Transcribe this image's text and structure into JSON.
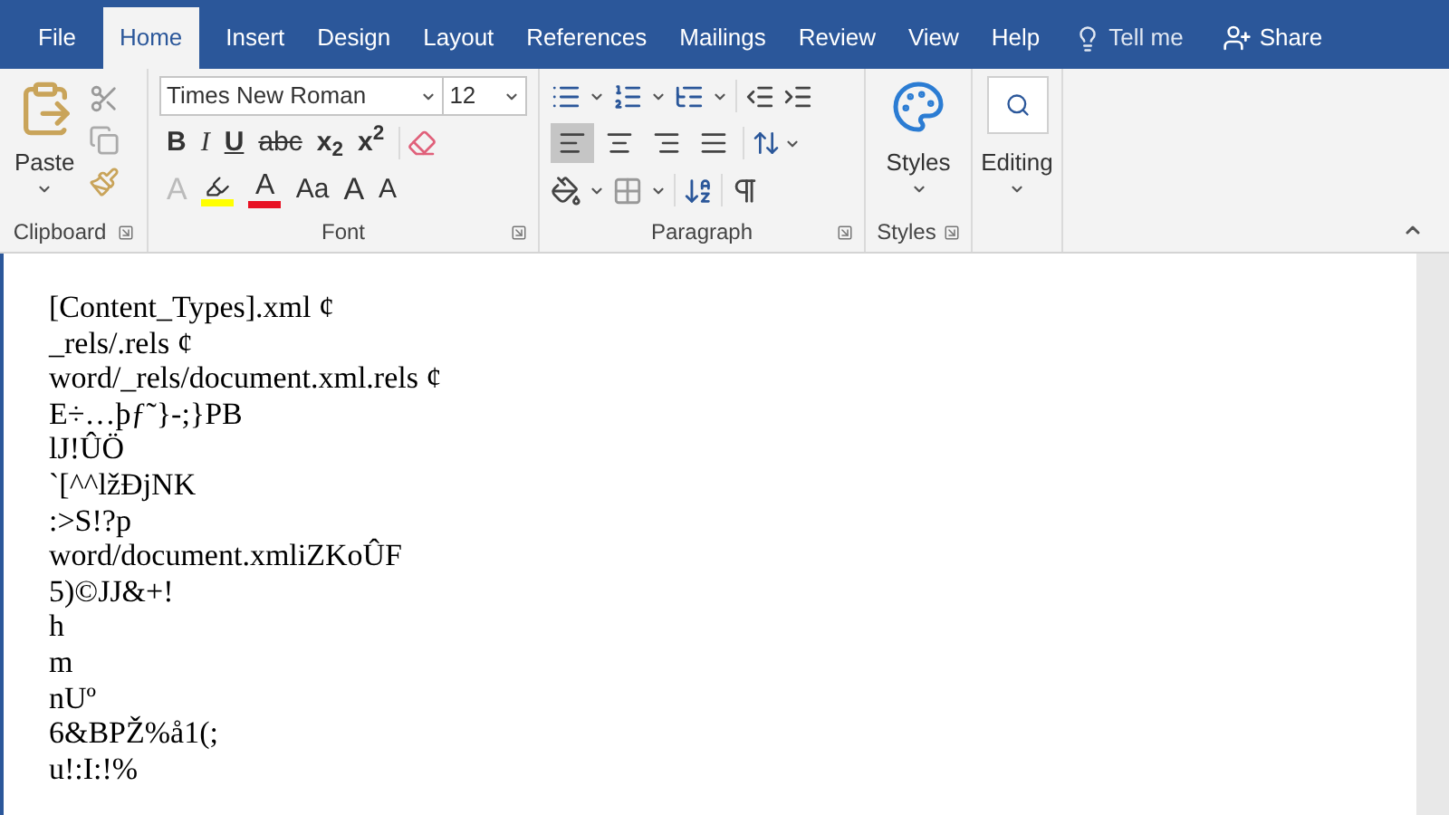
{
  "tabs": [
    {
      "label": "File",
      "selected": false
    },
    {
      "label": "Home",
      "selected": true
    },
    {
      "label": "Insert",
      "selected": false
    },
    {
      "label": "Design",
      "selected": false
    },
    {
      "label": "Layout",
      "selected": false
    },
    {
      "label": "References",
      "selected": false
    },
    {
      "label": "Mailings",
      "selected": false
    },
    {
      "label": "Review",
      "selected": false
    },
    {
      "label": "View",
      "selected": false
    },
    {
      "label": "Help",
      "selected": false
    }
  ],
  "tell_me": "Tell me",
  "share": "Share",
  "clipboard": {
    "label": "Clipboard",
    "paste": "Paste"
  },
  "font": {
    "label": "Font",
    "font_name": "Times New Roman",
    "font_size": "12",
    "row_1": [
      {
        "kind": "bold",
        "label": "B"
      },
      {
        "kind": "italic",
        "label": "I"
      },
      {
        "kind": "underline",
        "label": "U"
      },
      {
        "kind": "strike",
        "label": "abc"
      },
      {
        "kind": "plain",
        "label": "x$_{2}$"
      },
      {
        "kind": "plain",
        "label": "x$^{2}$"
      }
    ],
    "row_2": [
      {
        "kind": "effects",
        "label": "A"
      },
      {
        "kind": "highlight",
        "color": "#ffff00"
      },
      {
        "kind": "color",
        "label": "A",
        "color": "#e81123"
      },
      {
        "kind": "case",
        "label": "Aa"
      },
      {
        "kind": "grow",
        "label": "A"
      },
      {
        "kind": "shrink",
        "label": "A"
      }
    ]
  },
  "paragraph": {
    "label": "Paragraph",
    "alignment": [
      {
        "selected": true
      },
      {
        "selected": false
      },
      {
        "selected": false
      },
      {
        "selected": false
      }
    ]
  },
  "styles": {
    "label": "Styles",
    "button": "Styles"
  },
  "editing": {
    "button": "Editing"
  },
  "document_lines": [
    "[Content_Types].xml ¢",
    "_rels/.rels ¢",
    "word/_rels/document.xml.rels ¢",
    "E÷…þƒ˜}-;}PB",
    "lJ!ÛÖ",
    "`[^^lžÐjNK",
    ":>S!?p",
    "word/document.xmliZKoÛF",
    "5)©JJ&+!",
    "h",
    "m",
    "nUº",
    "6&BPŽ%å1(;",
    "u!:I:!%"
  ]
}
